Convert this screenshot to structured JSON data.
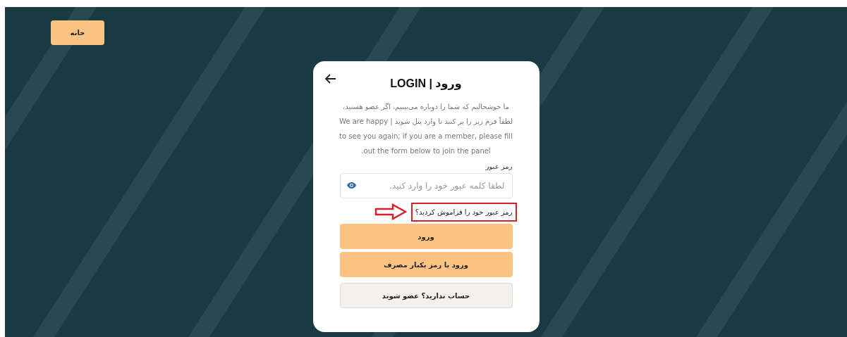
{
  "home_button": "خانه",
  "card": {
    "title": "ورود | LOGIN",
    "description": "ما خوشحالیم که شما را دوباره می‌بینیم، اگر عضو هستید، لطفاً فرم زیر را پر کنید تا وارد پنل شوید | We are happy to see you again; if you are a member, please fill out the form below to join the panel.",
    "password": {
      "label": "رمز عبور",
      "placeholder": "لطفا کلمه عبور خود را وارد کنید."
    },
    "forgot_link": {
      "label": "رمز عبور خود را فراموش کردید؟",
      "highlighted": true
    },
    "buttons": [
      {
        "label": "ورود",
        "kind": "primary"
      },
      {
        "label": "ورود با رمز یکبار مصرف",
        "kind": "primary"
      },
      {
        "label": "حساب ندارید؟ عضو شوید",
        "kind": "secondary"
      }
    ]
  }
}
